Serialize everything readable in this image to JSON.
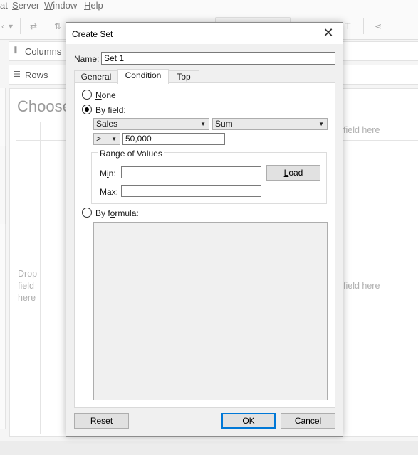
{
  "app": {
    "menu": [
      {
        "label": "at",
        "accel": ""
      },
      {
        "label": "Server",
        "accel": "S"
      },
      {
        "label": "Window",
        "accel": "W"
      },
      {
        "label": "Help",
        "accel": "H"
      }
    ],
    "shelves": {
      "columns_label": "Columns",
      "rows_label": "Rows"
    },
    "canvas": {
      "title_partial": "Choose",
      "drop_field_left": "Drop field here",
      "drop_field_right_1": "field here",
      "drop_field_right_2": "field here"
    }
  },
  "dialog": {
    "title": "Create Set",
    "name_label": "Name:",
    "name_value": "Set 1",
    "tabs": [
      {
        "label": "General",
        "active": false
      },
      {
        "label": "Condition",
        "active": true
      },
      {
        "label": "Top",
        "active": false
      }
    ],
    "condition": {
      "none_label": "None",
      "by_field_label": "By field:",
      "by_field_selected": true,
      "field_value": "Sales",
      "aggregation_value": "Sum",
      "operator_value": ">",
      "threshold_value": "50,000",
      "range_title": "Range of Values",
      "min_label": "Min:",
      "max_label": "Max:",
      "min_value": "",
      "max_value": "",
      "load_label": "Load",
      "by_formula_label": "By formula:",
      "formula_text": ""
    },
    "buttons": {
      "reset": "Reset",
      "ok": "OK",
      "cancel": "Cancel"
    }
  },
  "colors": {
    "accent": "#0078d7",
    "dialog_bg": "#f0f0f0"
  }
}
